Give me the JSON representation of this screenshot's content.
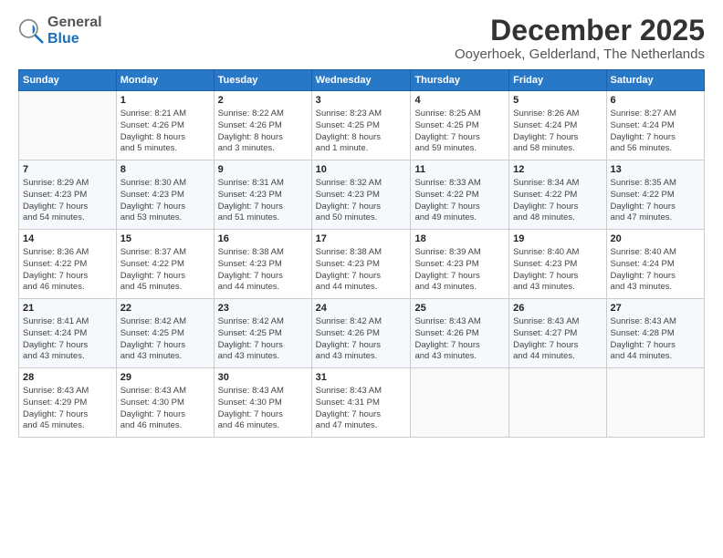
{
  "logo": {
    "general": "General",
    "blue": "Blue"
  },
  "title": "December 2025",
  "subtitle": "Ooyerhoek, Gelderland, The Netherlands",
  "weekdays": [
    "Sunday",
    "Monday",
    "Tuesday",
    "Wednesday",
    "Thursday",
    "Friday",
    "Saturday"
  ],
  "weeks": [
    [
      {
        "day": "",
        "text": ""
      },
      {
        "day": "1",
        "text": "Sunrise: 8:21 AM\nSunset: 4:26 PM\nDaylight: 8 hours\nand 5 minutes."
      },
      {
        "day": "2",
        "text": "Sunrise: 8:22 AM\nSunset: 4:26 PM\nDaylight: 8 hours\nand 3 minutes."
      },
      {
        "day": "3",
        "text": "Sunrise: 8:23 AM\nSunset: 4:25 PM\nDaylight: 8 hours\nand 1 minute."
      },
      {
        "day": "4",
        "text": "Sunrise: 8:25 AM\nSunset: 4:25 PM\nDaylight: 7 hours\nand 59 minutes."
      },
      {
        "day": "5",
        "text": "Sunrise: 8:26 AM\nSunset: 4:24 PM\nDaylight: 7 hours\nand 58 minutes."
      },
      {
        "day": "6",
        "text": "Sunrise: 8:27 AM\nSunset: 4:24 PM\nDaylight: 7 hours\nand 56 minutes."
      }
    ],
    [
      {
        "day": "7",
        "text": "Sunrise: 8:29 AM\nSunset: 4:23 PM\nDaylight: 7 hours\nand 54 minutes."
      },
      {
        "day": "8",
        "text": "Sunrise: 8:30 AM\nSunset: 4:23 PM\nDaylight: 7 hours\nand 53 minutes."
      },
      {
        "day": "9",
        "text": "Sunrise: 8:31 AM\nSunset: 4:23 PM\nDaylight: 7 hours\nand 51 minutes."
      },
      {
        "day": "10",
        "text": "Sunrise: 8:32 AM\nSunset: 4:23 PM\nDaylight: 7 hours\nand 50 minutes."
      },
      {
        "day": "11",
        "text": "Sunrise: 8:33 AM\nSunset: 4:22 PM\nDaylight: 7 hours\nand 49 minutes."
      },
      {
        "day": "12",
        "text": "Sunrise: 8:34 AM\nSunset: 4:22 PM\nDaylight: 7 hours\nand 48 minutes."
      },
      {
        "day": "13",
        "text": "Sunrise: 8:35 AM\nSunset: 4:22 PM\nDaylight: 7 hours\nand 47 minutes."
      }
    ],
    [
      {
        "day": "14",
        "text": "Sunrise: 8:36 AM\nSunset: 4:22 PM\nDaylight: 7 hours\nand 46 minutes."
      },
      {
        "day": "15",
        "text": "Sunrise: 8:37 AM\nSunset: 4:22 PM\nDaylight: 7 hours\nand 45 minutes."
      },
      {
        "day": "16",
        "text": "Sunrise: 8:38 AM\nSunset: 4:23 PM\nDaylight: 7 hours\nand 44 minutes."
      },
      {
        "day": "17",
        "text": "Sunrise: 8:38 AM\nSunset: 4:23 PM\nDaylight: 7 hours\nand 44 minutes."
      },
      {
        "day": "18",
        "text": "Sunrise: 8:39 AM\nSunset: 4:23 PM\nDaylight: 7 hours\nand 43 minutes."
      },
      {
        "day": "19",
        "text": "Sunrise: 8:40 AM\nSunset: 4:23 PM\nDaylight: 7 hours\nand 43 minutes."
      },
      {
        "day": "20",
        "text": "Sunrise: 8:40 AM\nSunset: 4:24 PM\nDaylight: 7 hours\nand 43 minutes."
      }
    ],
    [
      {
        "day": "21",
        "text": "Sunrise: 8:41 AM\nSunset: 4:24 PM\nDaylight: 7 hours\nand 43 minutes."
      },
      {
        "day": "22",
        "text": "Sunrise: 8:42 AM\nSunset: 4:25 PM\nDaylight: 7 hours\nand 43 minutes."
      },
      {
        "day": "23",
        "text": "Sunrise: 8:42 AM\nSunset: 4:25 PM\nDaylight: 7 hours\nand 43 minutes."
      },
      {
        "day": "24",
        "text": "Sunrise: 8:42 AM\nSunset: 4:26 PM\nDaylight: 7 hours\nand 43 minutes."
      },
      {
        "day": "25",
        "text": "Sunrise: 8:43 AM\nSunset: 4:26 PM\nDaylight: 7 hours\nand 43 minutes."
      },
      {
        "day": "26",
        "text": "Sunrise: 8:43 AM\nSunset: 4:27 PM\nDaylight: 7 hours\nand 44 minutes."
      },
      {
        "day": "27",
        "text": "Sunrise: 8:43 AM\nSunset: 4:28 PM\nDaylight: 7 hours\nand 44 minutes."
      }
    ],
    [
      {
        "day": "28",
        "text": "Sunrise: 8:43 AM\nSunset: 4:29 PM\nDaylight: 7 hours\nand 45 minutes."
      },
      {
        "day": "29",
        "text": "Sunrise: 8:43 AM\nSunset: 4:30 PM\nDaylight: 7 hours\nand 46 minutes."
      },
      {
        "day": "30",
        "text": "Sunrise: 8:43 AM\nSunset: 4:30 PM\nDaylight: 7 hours\nand 46 minutes."
      },
      {
        "day": "31",
        "text": "Sunrise: 8:43 AM\nSunset: 4:31 PM\nDaylight: 7 hours\nand 47 minutes."
      },
      {
        "day": "",
        "text": ""
      },
      {
        "day": "",
        "text": ""
      },
      {
        "day": "",
        "text": ""
      }
    ]
  ]
}
